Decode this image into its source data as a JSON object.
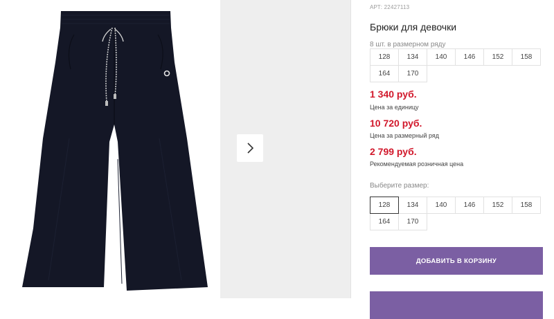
{
  "product": {
    "sku": "АРТ: 22427113",
    "title": "Брюки для девочки",
    "pack_label": "8 шт. в размерном ряду",
    "pack_sizes": [
      [
        "128",
        "134",
        "140",
        "146",
        "152",
        "158"
      ],
      [
        "164",
        "170"
      ]
    ],
    "price_unit": "1 340 руб.",
    "price_unit_note": "Цена за единицу",
    "price_pack": "10 720 руб.",
    "price_pack_note": "Цена за размерный ряд",
    "price_retail": "2 799 руб.",
    "price_retail_note": "Рекомендуемая розничная цена",
    "select_size_label": "Выберите размер:",
    "size_options": [
      [
        "128",
        "134",
        "140",
        "146",
        "152",
        "158"
      ],
      [
        "164",
        "170"
      ]
    ],
    "selected_size": "128",
    "add_to_cart": "ДОБАВИТЬ В КОРЗИНУ"
  },
  "colors": {
    "price": "#d1182b",
    "button": "#7b5fa3",
    "pants": "#151828"
  },
  "icons": {
    "next": "chevron-right-icon"
  }
}
